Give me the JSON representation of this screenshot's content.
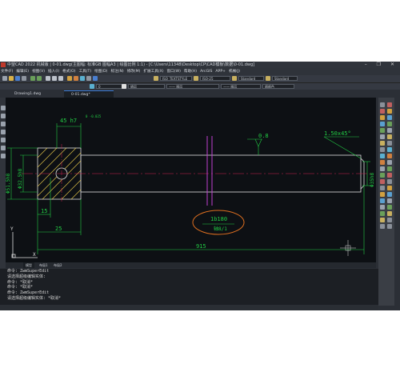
{
  "window": {
    "title": "中望CAD 2022 机械版 | 0-01.dwg(主图幅: 标准GB 图幅A3 | 绘图比例 1:1) - [C:\\Users\\11348\\Desktop\\CP\\CAD模板\\数据\\0-01.dwg]",
    "controls": "–  ❐  ✕"
  },
  "menu": {
    "items": [
      "文件(F)",
      "编辑(E)",
      "视图(V)",
      "插入(I)",
      "格式(O)",
      "工具(T)",
      "绘图(D)",
      "标注(N)",
      "修改(M)",
      "扩展工具(X)",
      "窗口(W)",
      "帮助(H)",
      "ArcGIS",
      "APP+",
      "机械(J)"
    ]
  },
  "toolbar": {
    "style_combo": "ISO_TEXTSTYLE",
    "dim_combo": "ISO-25",
    "table_combo": "Standard",
    "multileader_combo": "Standard"
  },
  "toolbar2": {
    "layer_combo": "0",
    "color_combo": "随层",
    "linetype_combo": "—— 随层",
    "lineweight_combo": "—— 随层",
    "plot_combo": "随颜色"
  },
  "tabs": [
    {
      "label": "Drawing1.dwg"
    },
    {
      "label": "0-01.dwg*"
    }
  ],
  "layout_tabs": [
    "模型",
    "布局1",
    "布局2"
  ],
  "drawing": {
    "labels": {
      "top_dim": "45 h7",
      "tol": "0 -0.025",
      "roughness": "0.8",
      "chamfer": "1.50x45°",
      "left_dia1": "Φ51.5h8",
      "left_dia2": "Φ32.5h8",
      "right_dia": "Φ35h8",
      "dim_15": "15",
      "dim_25": "25",
      "dim_915": "915",
      "circle_label1": "1b180",
      "circle_label2": "轴8/1",
      "axis_y": "Y",
      "axis_x": "X"
    }
  },
  "command": {
    "lines": [
      "命令: ZwmSuperEdit",
      "请选择超级编辑实体:",
      "命令: *取消*",
      "命令: *取消*",
      "命令: ZwmSuperEdit",
      "请选择超级编辑实体: *取消*"
    ]
  },
  "colors": {
    "accent": "#3d7dd8",
    "dim_green": "#22cc44",
    "part_white": "#e0e0e0",
    "hatch_yellow": "#e6c84a",
    "center_red": "#d02050",
    "magenta": "#c040d0",
    "highlight_orange": "#e07020"
  }
}
